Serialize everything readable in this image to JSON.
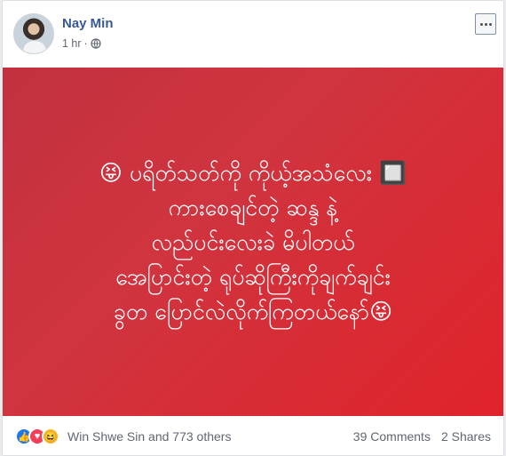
{
  "post": {
    "author": "Nay Min",
    "time": "1 hr",
    "separator": "·",
    "text": "😝 ပရိတ်သတ်ကို ကိုယ့်အသံလေး 🔲\nကားစေချင်တဲ့ ဆန္ဒ နဲ့\nလည်ပင်းလေးခဲ မိပါတယ်\nအေပြာင်းတဲ့ ရုပ်ဆိုကြီးကိုချက်ချင်း\nခွတ ပြောင်လဲလိုက်ကြတယ်နော်😝"
  },
  "footer": {
    "reactors": "Win Shwe Sin and 773 others",
    "comments": "39 Comments",
    "shares": "2 Shares"
  },
  "icons": {
    "like": "thumbs-up-icon",
    "love": "heart-icon",
    "haha": "laughing-face-icon",
    "privacy": "globe-icon",
    "menu": "more-options-icon"
  },
  "colors": {
    "post_background_start": "#c2313f",
    "post_background_end": "#e0232a",
    "author": "#385898"
  }
}
